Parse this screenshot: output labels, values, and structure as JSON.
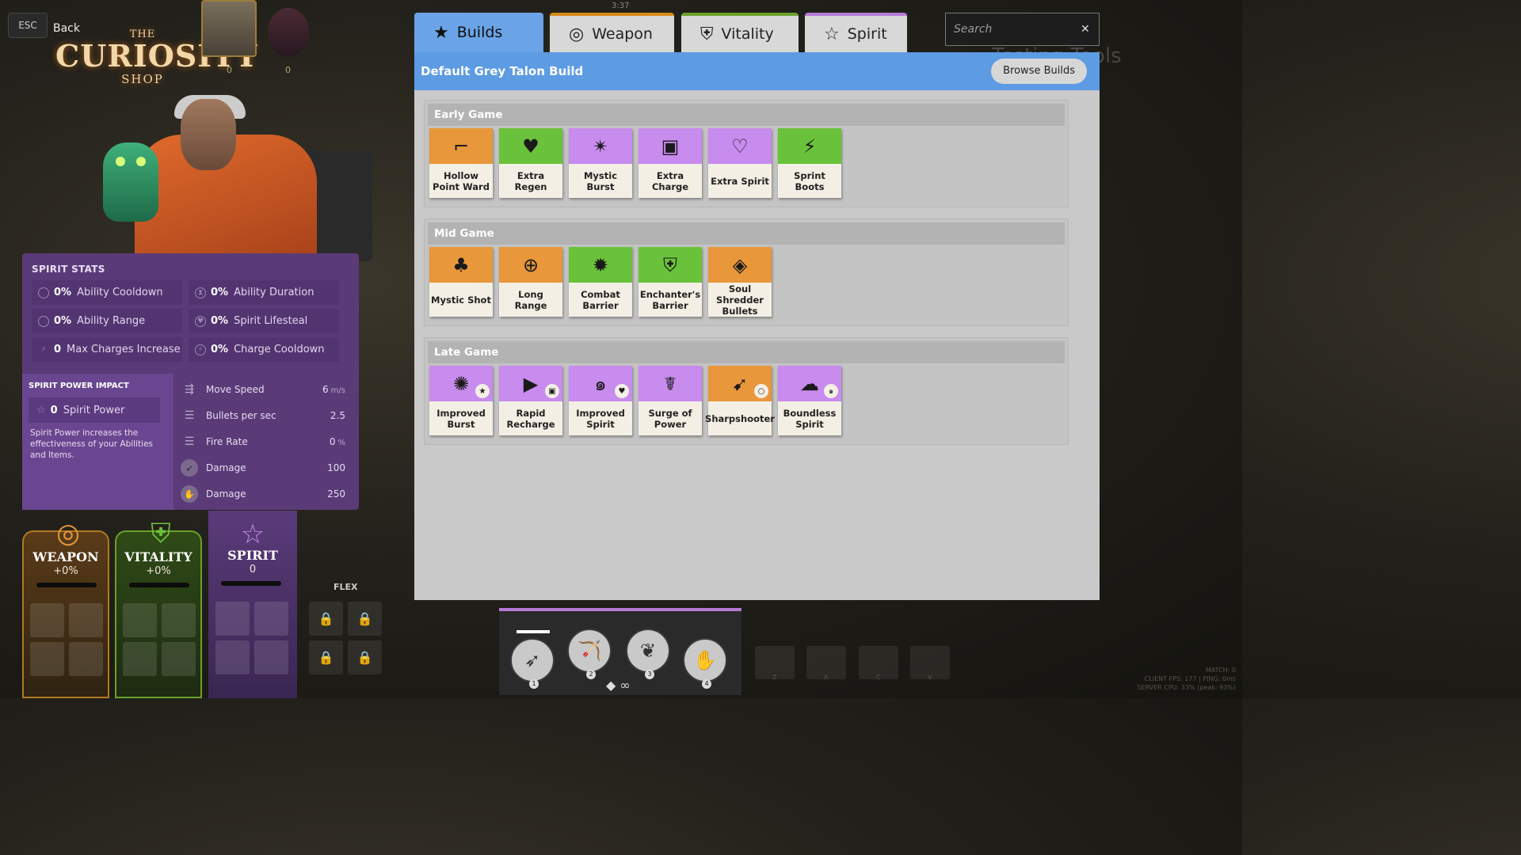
{
  "topbar": {
    "esc_label": "ESC",
    "back_label": "Back",
    "timer": "3:37",
    "portrait_counts": [
      "0",
      "0"
    ]
  },
  "shop_logo": {
    "the": "THE",
    "main": "CURIOSITY",
    "shop": "SHOP"
  },
  "background_text": "Testing Tools",
  "spirit_stats": {
    "title": "SPIRIT STATS",
    "rows": [
      {
        "icon": "cooldown-icon",
        "value": "0%",
        "label": "Ability Cooldown"
      },
      {
        "icon": "duration-icon",
        "value": "0%",
        "label": "Ability Duration"
      },
      {
        "icon": "range-icon",
        "value": "0%",
        "label": "Ability Range"
      },
      {
        "icon": "lifesteal-icon",
        "value": "0%",
        "label": "Spirit Lifesteal"
      },
      {
        "icon": "charges-icon",
        "value": "0",
        "label": "Max Charges Increase"
      },
      {
        "icon": "charge-cooldown-icon",
        "value": "0%",
        "label": "Charge Cooldown"
      }
    ],
    "power_impact_title": "SPIRIT POWER IMPACT",
    "spirit_power_value": "0",
    "spirit_power_label": "Spirit Power",
    "description": "Spirit Power increases the effectiveness of your Abilities and Items.",
    "weapon_stats": [
      {
        "icon": "move-speed-icon",
        "label": "Move Speed",
        "value": "6",
        "unit": "m/s"
      },
      {
        "icon": "bullets-icon",
        "label": "Bullets per sec",
        "value": "2.5",
        "unit": ""
      },
      {
        "icon": "fire-rate-icon",
        "label": "Fire Rate",
        "value": "0",
        "unit": "%"
      },
      {
        "icon": "arrow-damage-icon",
        "label": "Damage",
        "value": "100",
        "unit": ""
      },
      {
        "icon": "claw-damage-icon",
        "label": "Damage",
        "value": "250",
        "unit": ""
      }
    ]
  },
  "categories": {
    "weapon": {
      "label": "WEAPON",
      "value": "+0%",
      "color": "#b07a22"
    },
    "vitality": {
      "label": "VITALITY",
      "value": "+0%",
      "color": "#6aa12a"
    },
    "spirit": {
      "label": "SPIRIT",
      "value": "0",
      "color": "#b57ad6"
    },
    "flex_label": "FLEX"
  },
  "tabs": [
    {
      "label": "Builds",
      "icon": "star-icon",
      "active": true
    },
    {
      "label": "Weapon",
      "icon": "weapon-icon",
      "active": false
    },
    {
      "label": "Vitality",
      "icon": "vitality-icon",
      "active": false
    },
    {
      "label": "Spirit",
      "icon": "spirit-icon",
      "active": false
    }
  ],
  "search": {
    "placeholder": "Search"
  },
  "build": {
    "title": "Default Grey Talon Build",
    "browse_label": "Browse Builds",
    "sections": [
      {
        "title": "Early Game",
        "items": [
          {
            "name": "Hollow Point Ward",
            "type": "weapon",
            "icon": "pistol-icon"
          },
          {
            "name": "Extra Regen",
            "type": "vitality",
            "icon": "heart-icon"
          },
          {
            "name": "Mystic Burst",
            "type": "spirit",
            "icon": "burst-icon"
          },
          {
            "name": "Extra Charge",
            "type": "spirit",
            "icon": "battery-icon"
          },
          {
            "name": "Extra Spirit",
            "type": "spirit",
            "icon": "heart-spark-icon"
          },
          {
            "name": "Sprint Boots",
            "type": "vitality",
            "icon": "boot-icon"
          }
        ]
      },
      {
        "title": "Mid Game",
        "items": [
          {
            "name": "Mystic Shot",
            "type": "weapon",
            "icon": "tree-icon"
          },
          {
            "name": "Long Range",
            "type": "weapon",
            "icon": "crosshair-icon"
          },
          {
            "name": "Combat Barrier",
            "type": "vitality",
            "icon": "barrier-icon"
          },
          {
            "name": "Enchanter's Barrier",
            "type": "vitality",
            "icon": "shield-icon"
          },
          {
            "name": "Soul Shredder Bullets",
            "type": "weapon",
            "icon": "diamond-arrow-icon"
          }
        ]
      },
      {
        "title": "Late Game",
        "items": [
          {
            "name": "Improved Burst",
            "type": "spirit",
            "icon": "gear-burst-icon"
          },
          {
            "name": "Rapid Recharge",
            "type": "spirit",
            "icon": "recharge-icon"
          },
          {
            "name": "Improved Spirit",
            "type": "spirit",
            "icon": "swirl-icon"
          },
          {
            "name": "Surge of Power",
            "type": "spirit",
            "icon": "surge-icon"
          },
          {
            "name": "Sharpshooter",
            "type": "weapon",
            "icon": "sharpshooter-icon"
          },
          {
            "name": "Boundless Spirit",
            "type": "spirit",
            "icon": "spirit-cloud-icon"
          }
        ]
      }
    ]
  },
  "abilities": [
    {
      "key": "1",
      "icon": "arrow-icon"
    },
    {
      "key": "2",
      "icon": "archer-icon"
    },
    {
      "key": "3",
      "icon": "hawk-icon"
    },
    {
      "key": "4",
      "icon": "totem-icon"
    }
  ],
  "hotkeys": [
    "Z",
    "X",
    "C",
    "V"
  ],
  "net_info": [
    "MATCH: 0",
    "CLIENT FPS: 177 | PING: 0ms",
    "SERVER CPU: 33% (peak: 93%)"
  ]
}
